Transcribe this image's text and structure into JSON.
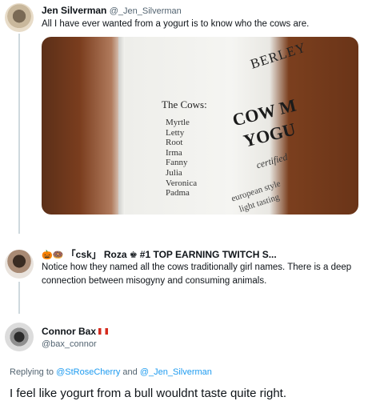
{
  "tweet1": {
    "name": "Jen Silverman",
    "handle": "@_Jen_Silverman",
    "text": "All I have ever wanted from a yogurt is to know who the cows are.",
    "photo": {
      "brand_line1": "BERLEY",
      "brand_line2": "COW M",
      "brand_line3": "YOGU",
      "cows_title": "The Cows:",
      "cows": [
        "Myrtle",
        "Letty",
        "Root",
        "Irma",
        "Fanny",
        "Julia",
        "Veronica",
        "Padma"
      ],
      "certified": "certified",
      "european": "european style",
      "light": "light tasting"
    }
  },
  "tweet2": {
    "emoji": "🎃🍩",
    "name_prefix": "「csk」",
    "name": "Roza",
    "name_suffix": "#1 TOP EARNING TWITCH S...",
    "text": "Notice how they named all the cows traditionally girl names. There is a deep connection between misogyny and consuming animals."
  },
  "tweet3": {
    "name": "Connor Bax",
    "handle": "@bax_connor",
    "replying_prefix": "Replying to",
    "reply_mention1": "@StRoseCherry",
    "reply_and": "and",
    "reply_mention2": "@_Jen_Silverman",
    "text": "I feel like yogurt from a bull wouldnt taste quite right."
  }
}
